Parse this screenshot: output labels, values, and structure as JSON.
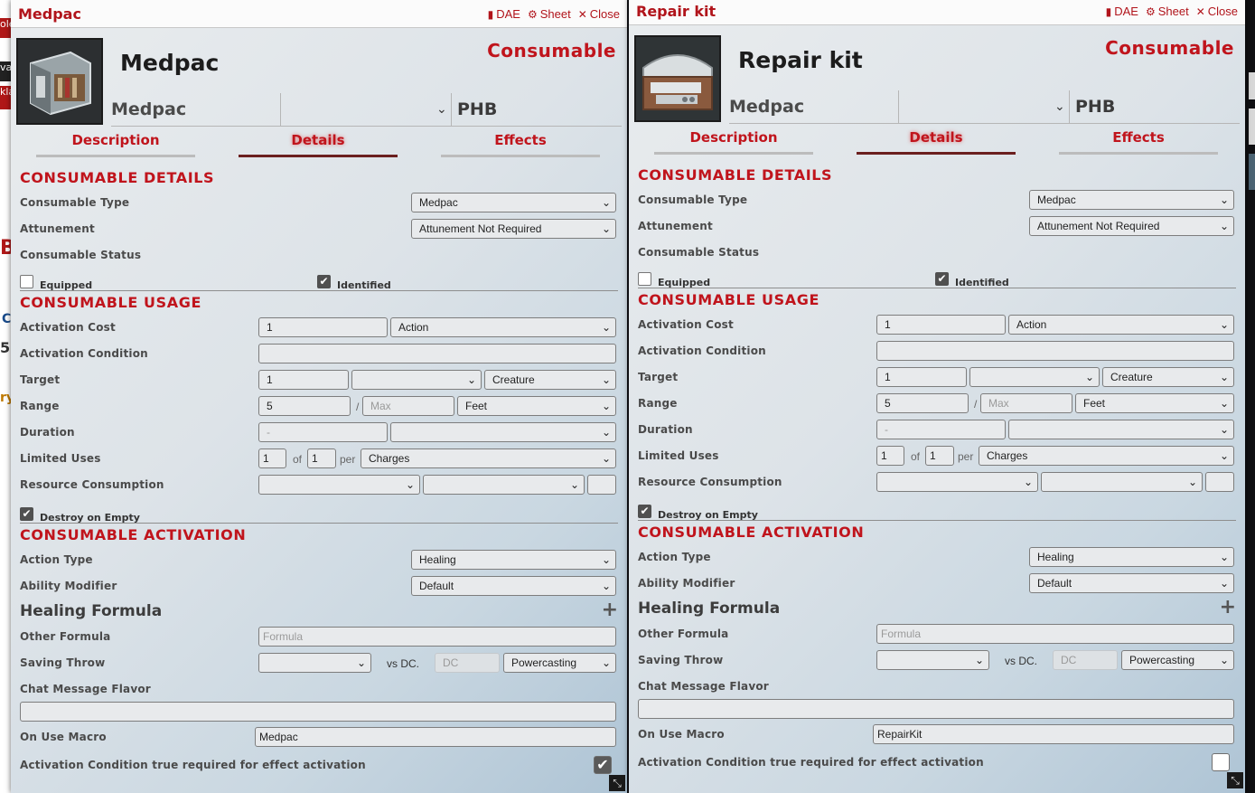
{
  "windows": [
    {
      "title": "Medpac",
      "header_buttons": {
        "dae": "DAE",
        "sheet": "Sheet",
        "close": "Close"
      },
      "item_name": "Medpac",
      "item_type": "Consumable",
      "subtitle_type": "Medpac",
      "source": "PHB",
      "tabs": {
        "description": "Description",
        "details": "Details",
        "effects": "Effects"
      },
      "consumable_details": {
        "heading": "CONSUMABLE DETAILS",
        "type_label": "Consumable Type",
        "type_value": "Medpac",
        "attunement_label": "Attunement",
        "attunement_value": "Attunement Not Required",
        "status_label": "Consumable Status",
        "equipped_label": "Equipped",
        "identified_label": "Identified"
      },
      "consumable_usage": {
        "heading": "CONSUMABLE USAGE",
        "activation_cost_label": "Activation Cost",
        "activation_cost_value": "1",
        "activation_type": "Action",
        "activation_condition_label": "Activation Condition",
        "target_label": "Target",
        "target_value": "1",
        "target_type": "Creature",
        "range_label": "Range",
        "range_value": "5",
        "range_sep": "/",
        "range_max_placeholder": "Max",
        "range_units": "Feet",
        "duration_label": "Duration",
        "duration_placeholder": "-",
        "limited_uses_label": "Limited Uses",
        "uses_value": "1",
        "uses_of": "of",
        "uses_max": "1",
        "uses_per": "per",
        "uses_period": "Charges",
        "resource_label": "Resource Consumption",
        "destroy_label": "Destroy on Empty"
      },
      "consumable_activation": {
        "heading": "CONSUMABLE ACTIVATION",
        "action_type_label": "Action Type",
        "action_type_value": "Healing",
        "ability_label": "Ability Modifier",
        "ability_value": "Default",
        "healing_heading": "Healing Formula",
        "add_icon": "+",
        "other_formula_label": "Other Formula",
        "other_formula_placeholder": "Formula",
        "saving_throw_label": "Saving Throw",
        "vs_dc": "vs DC.",
        "dc_placeholder": "DC",
        "save_scaling": "Powercasting",
        "chat_flavor_label": "Chat Message Flavor",
        "macro_label": "On Use Macro",
        "macro_value": "Medpac",
        "condition_required_label": "Activation Condition true required for effect activation",
        "condition_required_checked": true
      },
      "checks": {
        "equipped": false,
        "identified": true,
        "destroy": true
      }
    },
    {
      "title": "Repair kit",
      "header_buttons": {
        "dae": "DAE",
        "sheet": "Sheet",
        "close": "Close"
      },
      "item_name": "Repair kit",
      "item_type": "Consumable",
      "subtitle_type": "Medpac",
      "source": "PHB",
      "tabs": {
        "description": "Description",
        "details": "Details",
        "effects": "Effects"
      },
      "consumable_details": {
        "heading": "CONSUMABLE DETAILS",
        "type_label": "Consumable Type",
        "type_value": "Medpac",
        "attunement_label": "Attunement",
        "attunement_value": "Attunement Not Required",
        "status_label": "Consumable Status",
        "equipped_label": "Equipped",
        "identified_label": "Identified"
      },
      "consumable_usage": {
        "heading": "CONSUMABLE USAGE",
        "activation_cost_label": "Activation Cost",
        "activation_cost_value": "1",
        "activation_type": "Action",
        "activation_condition_label": "Activation Condition",
        "target_label": "Target",
        "target_value": "1",
        "target_type": "Creature",
        "range_label": "Range",
        "range_value": "5",
        "range_sep": "/",
        "range_max_placeholder": "Max",
        "range_units": "Feet",
        "duration_label": "Duration",
        "duration_placeholder": "-",
        "limited_uses_label": "Limited Uses",
        "uses_value": "1",
        "uses_of": "of",
        "uses_max": "1",
        "uses_per": "per",
        "uses_period": "Charges",
        "resource_label": "Resource Consumption",
        "destroy_label": "Destroy on Empty"
      },
      "consumable_activation": {
        "heading": "CONSUMABLE ACTIVATION",
        "action_type_label": "Action Type",
        "action_type_value": "Healing",
        "ability_label": "Ability Modifier",
        "ability_value": "Default",
        "healing_heading": "Healing Formula",
        "add_icon": "+",
        "other_formula_label": "Other Formula",
        "other_formula_placeholder": "Formula",
        "saving_throw_label": "Saving Throw",
        "vs_dc": "vs DC.",
        "dc_placeholder": "DC",
        "save_scaling": "Powercasting",
        "chat_flavor_label": "Chat Message Flavor",
        "macro_label": "On Use Macro",
        "macro_value": "RepairKit",
        "condition_required_label": "Activation Condition true required for effect activation",
        "condition_required_checked": false
      },
      "checks": {
        "equipped": false,
        "identified": true,
        "destroy": true
      }
    }
  ],
  "background": {
    "fragments": [
      "ole",
      "va",
      "kla",
      "BE",
      "C",
      "5",
      "ry"
    ]
  },
  "colors": {
    "accent": "#c0141c",
    "window_bg": "#dde3e8"
  }
}
